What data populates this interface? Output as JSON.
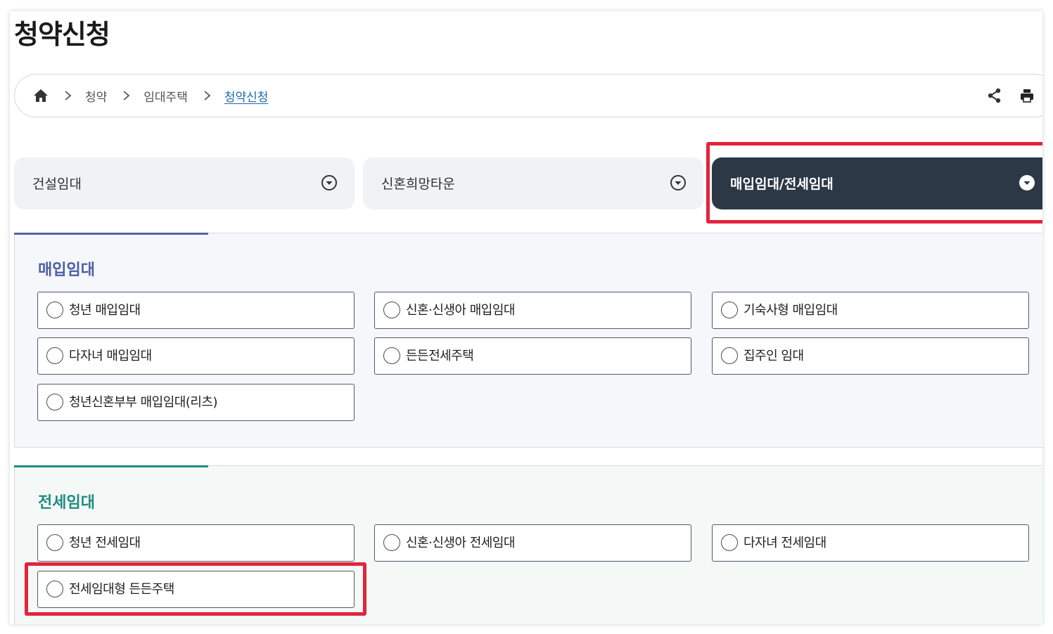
{
  "page": {
    "title": "청약신청"
  },
  "breadcrumb": {
    "home_icon": "home-icon",
    "items": [
      "청약",
      "임대주택",
      "청약신청"
    ],
    "tools": [
      "share-icon",
      "print-icon"
    ]
  },
  "tabs": [
    {
      "label": "건설임대",
      "icon": "chevron-down-circle-icon",
      "active": false
    },
    {
      "label": "신혼희망타운",
      "icon": "chevron-down-circle-icon",
      "active": false
    },
    {
      "label": "매입임대/전세임대",
      "icon": "chevron-down-circle-icon",
      "active": true
    }
  ],
  "sections": [
    {
      "title": "매입임대",
      "accent_color": "#5563a7",
      "options": [
        "청년 매입임대",
        "신혼·신생아 매입임대",
        "기숙사형 매입임대",
        "다자녀 매입임대",
        "든든전세주택",
        "집주인 임대",
        "청년신혼부부 매입임대(리츠)"
      ]
    },
    {
      "title": "전세임대",
      "accent_color": "#1f8c80",
      "options": [
        "청년 전세임대",
        "신혼·신생아 전세임대",
        "다자녀 전세임대",
        "전세임대형 든든주택"
      ]
    }
  ],
  "colors": {
    "active_tab_bg": "#2d3846",
    "highlight": "#e2253b",
    "link": "#1b6ea8"
  }
}
